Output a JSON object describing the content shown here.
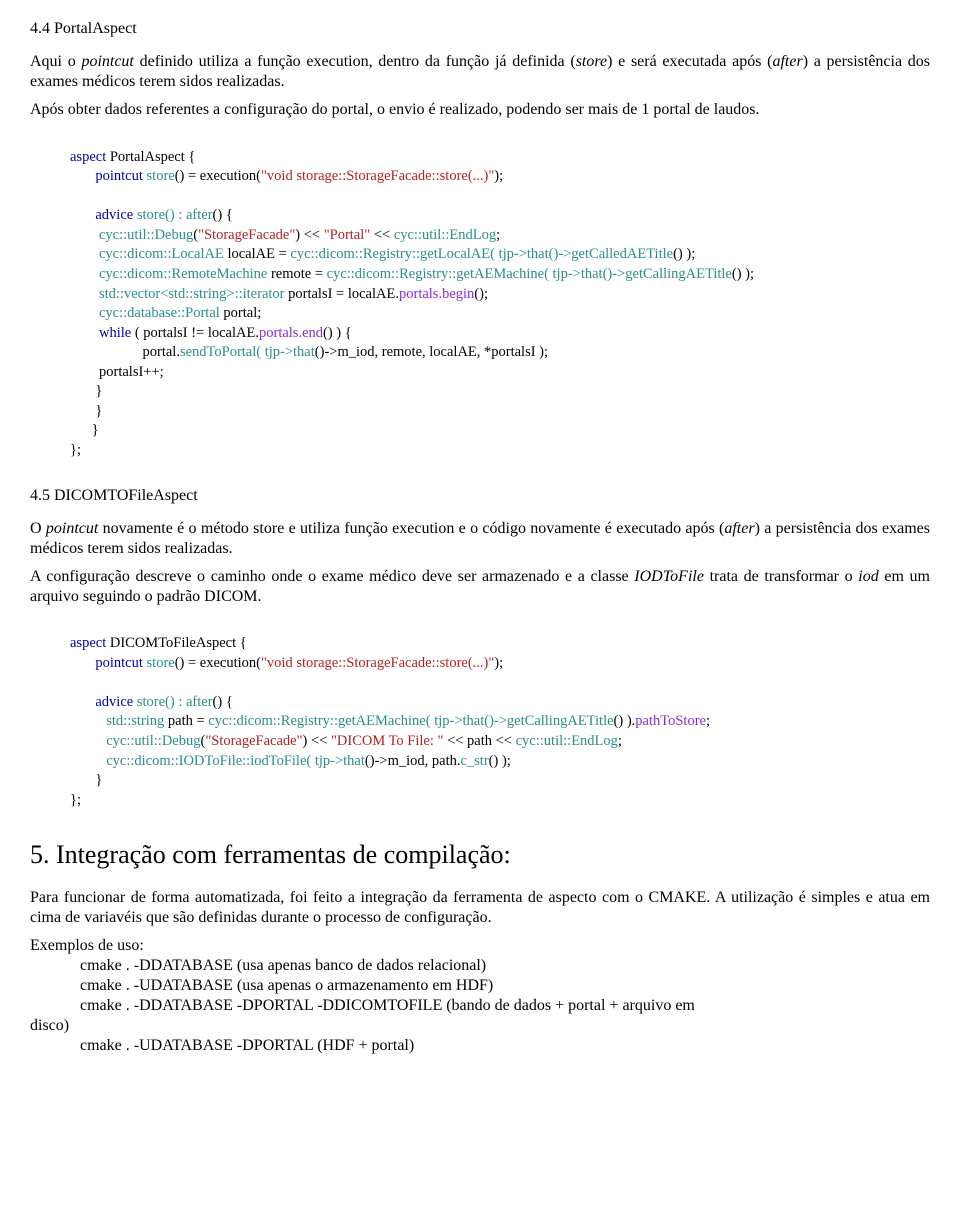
{
  "s44": {
    "heading": "4.4 PortalAspect",
    "para1_a": "Aqui o ",
    "para1_b": "pointcut",
    "para1_c": " definido utiliza a função  execution, dentro da função já definida (",
    "para1_d": "store",
    "para1_e": ") e será executada após (",
    "para1_f": "after",
    "para1_g": ") a persistência dos exames médicos terem sidos realizadas.",
    "para2": "Após obter dados referentes a configuração do portal, o envio é realizado, podendo ser mais de 1 portal de laudos.",
    "code": {
      "l1a": "aspect",
      "l1b": " PortalAspect {",
      "l2a": "pointcut",
      "l2b": " store",
      "l2c": "() = execution(",
      "l2d": "\"void storage::StorageFacade::store(...)\"",
      "l2e": ");",
      "l3a": "advice",
      "l3b": " store",
      "l3c": "() : after",
      "l3d": "() {",
      "l4a": "cyc::util::Debug",
      "l4b": "(",
      "l4c": "\"StorageFacade\"",
      "l4d": ") << ",
      "l4e": "\"Portal\"",
      "l4f": " << ",
      "l4g": "cyc::util::EndLog",
      "l4h": ";",
      "l5a": "cyc::dicom::LocalAE",
      "l5b": " localAE = ",
      "l5c": "cyc::dicom::Registry::getLocalAE",
      "l5d": "( tjp->that",
      "l5e": "()->getCalledAETitle",
      "l5f": "() );",
      "l6a": "cyc::dicom::RemoteMachine",
      "l6b": " remote = ",
      "l6c": "cyc::dicom::Registry::getAEMachine",
      "l6d": "( tjp->that",
      "l6e": "()->getCallingAETitle",
      "l6f": "() );",
      "l7a": "std::vector<std::string>::iterator",
      "l7b": " portalsI = localAE.",
      "l7c": "portals.begin",
      "l7d": "();",
      "l8a": "cyc::database::Portal",
      "l8b": " portal;",
      "l9a": "while",
      "l9b": " ( portalsI != localAE.",
      "l9c": "portals.end",
      "l9d": "() ) {",
      "l10a": "portal.",
      "l10b": "sendToPortal",
      "l10c": "( tjp->that",
      "l10d": "()->m_iod, remote, localAE, *portalsI );",
      "l11": "portalsI++;",
      "l12": "}",
      "l13": "}",
      "l14": "}",
      "l15": "};"
    }
  },
  "s45": {
    "heading": "4.5 DICOMTOFileAspect",
    "para1_a": "O ",
    "para1_b": "pointcut",
    "para1_c": " novamente é o método store e utiliza função execution e  o código novamente é executado após (",
    "para1_d": "after",
    "para1_e": ") a persistência dos exames médicos terem sidos realizadas.",
    "para2_a": "A configuração descreve o caminho onde o exame médico deve ser armazenado e a classe ",
    "para2_b": "IODToFile",
    "para2_c": " trata de transformar o ",
    "para2_d": "iod",
    "para2_e": " em um arquivo seguindo o padrão DICOM.",
    "code": {
      "l1a": "aspect",
      "l1b": " DICOMToFileAspect {",
      "l2a": "pointcut",
      "l2b": " store",
      "l2c": "() = execution(",
      "l2d": "\"void storage::StorageFacade::store(...)\"",
      "l2e": ");",
      "l3a": "advice",
      "l3b": " store",
      "l3c": "() : after",
      "l3d": "() {",
      "l4a": "std::string",
      "l4b": " path = ",
      "l4c": "cyc::dicom::Registry::getAEMachine",
      "l4d": "( tjp->that",
      "l4e": "()->getCallingAETitle",
      "l4f": "() ).",
      "l4g": "pathToStore",
      "l4h": ";",
      "l5a": "cyc::util::Debug",
      "l5b": "(",
      "l5c": "\"StorageFacade\"",
      "l5d": ") << ",
      "l5e": "\"DICOM To File: \"",
      "l5f": " << path << ",
      "l5g": "cyc::util::EndLog",
      "l5h": ";",
      "l6a": "cyc::dicom::IODToFile::iodToFile",
      "l6b": "( tjp->that",
      "l6c": "()->m_iod, path.",
      "l6d": "c_str",
      "l6e": "() );",
      "l7": "}",
      "l8": "};"
    }
  },
  "s5": {
    "heading": "5. Integração com ferramentas de compilação:",
    "para1": "Para funcionar de forma automatizada, foi feito a integração da ferramenta de aspecto com o CMAKE. A utilização é simples e atua em cima de variavéis que são definidas durante o processo de configuração.",
    "examples_label": "Exemplos de uso:",
    "ex1": "cmake . -DDATABASE (usa apenas banco de dados relacional)",
    "ex2": "cmake . -UDATABASE (usa apenas o armazenamento em HDF)",
    "ex3a": "cmake . -DDATABASE -DPORTAL -DDICOMTOFILE (bando de dados + portal + arquivo em",
    "ex3b": "disco)",
    "ex4": "cmake . -UDATABASE -DPORTAL (HDF + portal)"
  }
}
